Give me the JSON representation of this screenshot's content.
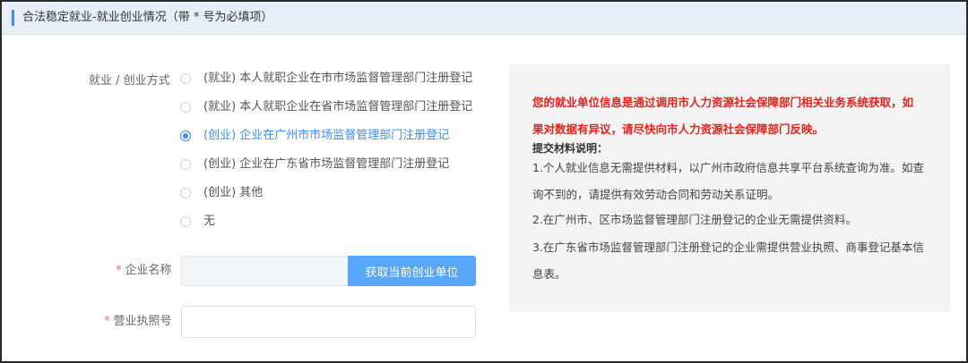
{
  "header": {
    "title": "合法稳定就业-就业创业情况（带 * 号为必填项）"
  },
  "form": {
    "mode_label": "就业 / 创业方式",
    "options": [
      {
        "label": "(就业) 本人就职企业在市市场监督管理部门注册登记",
        "checked": false
      },
      {
        "label": "(就业) 本人就职企业在省市场监督管理部门注册登记",
        "checked": false
      },
      {
        "label": "(创业) 企业在广州市市场监督管理部门注册登记",
        "checked": true
      },
      {
        "label": "(创业) 企业在广东省市场监督管理部门注册登记",
        "checked": false
      },
      {
        "label": "(创业) 其他",
        "checked": false
      },
      {
        "label": "无",
        "checked": false
      }
    ],
    "required_mark": "*",
    "company_label": "企业名称",
    "company_value": "",
    "fetch_button": "获取当前创业单位",
    "license_label": "营业执照号",
    "license_value": ""
  },
  "info": {
    "warning_line1": "您的就业单位信息是通过调用市人力资源社会保障部门相关业务系统获取，如",
    "warning_line2": "果对数据有异议，请尽快向市人力资源社会保障部门反映。",
    "title": "提交材料说明：",
    "lines": [
      "1.个人就业信息无需提供材料，以广州市政府信息共享平台系统查询为准。如查",
      "询不到的，请提供有效劳动合同和劳动关系证明。",
      "2.在广州市、区市场监督管理部门注册登记的企业无需提供资料。",
      "3.在广东省市场监督管理部门注册登记的企业需提供营业执照、商事登记基本信",
      "息表。"
    ]
  },
  "colors": {
    "accent": "#3e8ef7",
    "button": "#58a6f7",
    "warning": "#e8211b",
    "required": "#f56c6c"
  }
}
